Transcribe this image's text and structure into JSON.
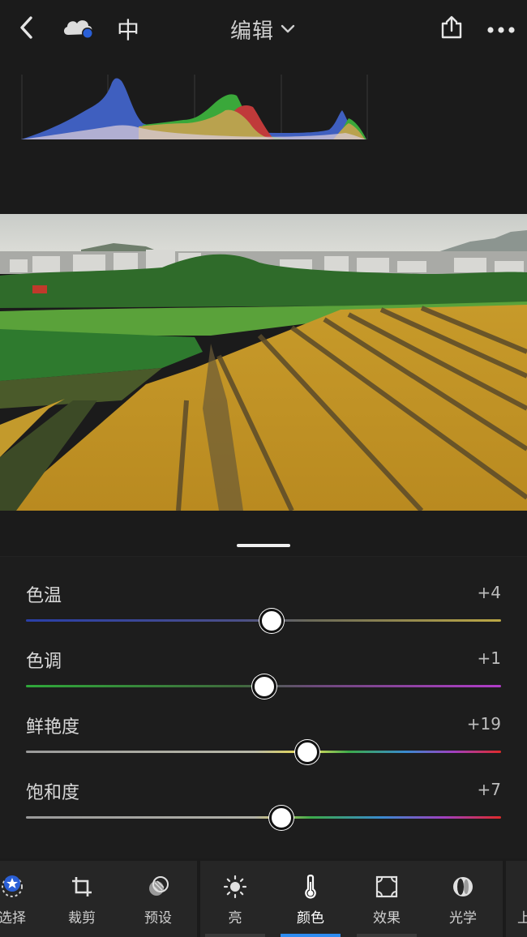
{
  "topbar": {
    "back_icon": "chevron-left-icon",
    "cloud_icon": "cloud-sync-icon",
    "language_label": "中",
    "title": "编辑",
    "share_icon": "share-icon",
    "more_icon": "more-icon"
  },
  "colors": {
    "background": "#1b1b1b",
    "panel": "#1d1d1d",
    "accent": "#2e8cf0",
    "histogram_blue": "#3f5fbf",
    "histogram_green": "#3aa83a",
    "histogram_red": "#c03a3a",
    "histogram_yellow": "#b9a24e"
  },
  "sliders": [
    {
      "label": "色温",
      "value": "+4",
      "level": 0.515,
      "track": "temperature"
    },
    {
      "label": "色调",
      "value": "+1",
      "level": 0.5,
      "track": "tint"
    },
    {
      "label": "鲜艳度",
      "value": "+19",
      "level": 0.59,
      "track": "vibrance"
    },
    {
      "label": "饱和度",
      "value": "+7",
      "level": 0.535,
      "track": "saturation"
    }
  ],
  "toolbar": {
    "items": [
      {
        "label": "选择",
        "icon": "selective-star-icon"
      },
      {
        "label": "裁剪",
        "icon": "crop-icon"
      },
      {
        "label": "预设",
        "icon": "presets-icon"
      },
      {
        "label": "亮",
        "icon": "sun-icon"
      },
      {
        "label": "颜色",
        "icon": "thermometer-icon",
        "active": true
      },
      {
        "label": "效果",
        "icon": "effects-icon"
      },
      {
        "label": "光学",
        "icon": "optics-lens-icon"
      },
      {
        "label": "上",
        "icon": ""
      }
    ]
  }
}
